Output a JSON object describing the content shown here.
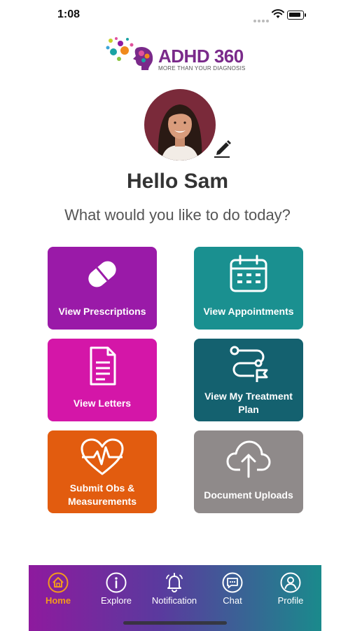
{
  "status_bar": {
    "time": "1:08"
  },
  "logo": {
    "title": "ADHD 360",
    "tagline": "MORE THAN YOUR DIAGNOSIS"
  },
  "greeting": "Hello Sam",
  "question": "What would you like to do today?",
  "tiles": [
    {
      "label": "View Prescriptions",
      "icon": "pill-icon",
      "color": "#9a1aa8"
    },
    {
      "label": "View Appointments",
      "icon": "calendar-icon",
      "color": "#1a9090"
    },
    {
      "label": "View Letters",
      "icon": "document-icon",
      "color": "#d416a8"
    },
    {
      "label": "View My Treatment Plan",
      "icon": "route-icon",
      "color": "#14616f"
    },
    {
      "label": "Submit Obs & Measurements",
      "icon": "heart-pulse-icon",
      "color": "#e25c0f"
    },
    {
      "label": "Document Uploads",
      "icon": "cloud-upload-icon",
      "color": "#8f8a8a"
    }
  ],
  "nav": [
    {
      "label": "Home",
      "icon": "home-icon",
      "active": true,
      "active_color": "#f39a1c"
    },
    {
      "label": "Explore",
      "icon": "info-icon",
      "active": false
    },
    {
      "label": "Notification",
      "icon": "bell-icon",
      "active": false
    },
    {
      "label": "Chat",
      "icon": "chat-icon",
      "active": false
    },
    {
      "label": "Profile",
      "icon": "user-icon",
      "active": false
    }
  ]
}
